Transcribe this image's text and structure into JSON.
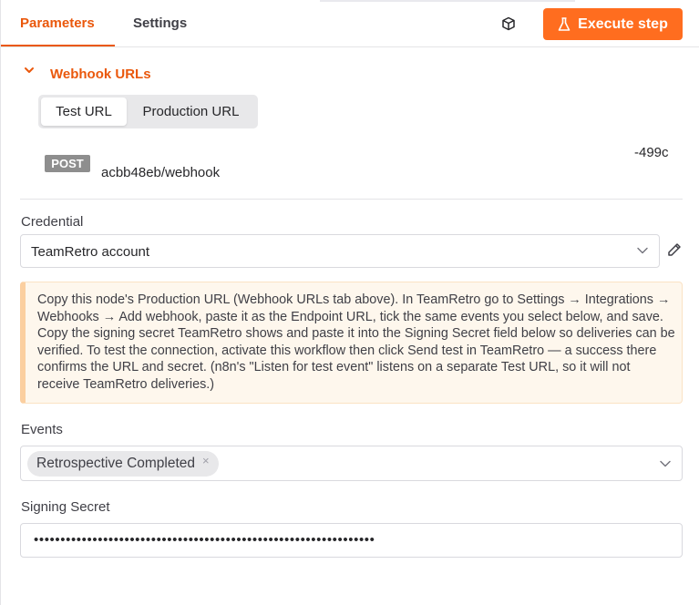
{
  "tabs": {
    "parameters": "Parameters",
    "settings": "Settings"
  },
  "header": {
    "execute_label": "Execute step",
    "execute_icon": "flask-icon",
    "cube_icon": "cube-icon",
    "accent_color": "#ff6d1f"
  },
  "webhook": {
    "section_title": "Webhook URLs",
    "url_tabs": [
      "Test URL",
      "Production URL"
    ],
    "selected_tab": "Test URL",
    "method": "POST",
    "url_tail": "-499c",
    "url_path": "acbb48eb/webhook"
  },
  "credential": {
    "label": "Credential",
    "value": "TeamRetro account",
    "edit_icon": "pencil-icon"
  },
  "notice": {
    "text": "Copy this node's Production URL (Webhook URLs tab above). In TeamRetro go to Settings → Integrations → Webhooks → Add webhook, paste it as the Endpoint URL, tick the same events you select below, and save. Copy the signing secret TeamRetro shows and paste it into the Signing Secret field below so deliveries can be verified. To test the connection, activate this workflow then click Send test in TeamRetro — a success there confirms the URL and secret. (n8n's \"Listen for test event\" listens on a separate Test URL, so it will not receive TeamRetro deliveries.)"
  },
  "events": {
    "label": "Events",
    "selected": [
      "Retrospective Completed"
    ],
    "remove_glyph": "×"
  },
  "signing_secret": {
    "label": "Signing Secret",
    "value": "••••••••••••••••••••••••••••••••••••••••••••••••••••••••••••••••"
  }
}
